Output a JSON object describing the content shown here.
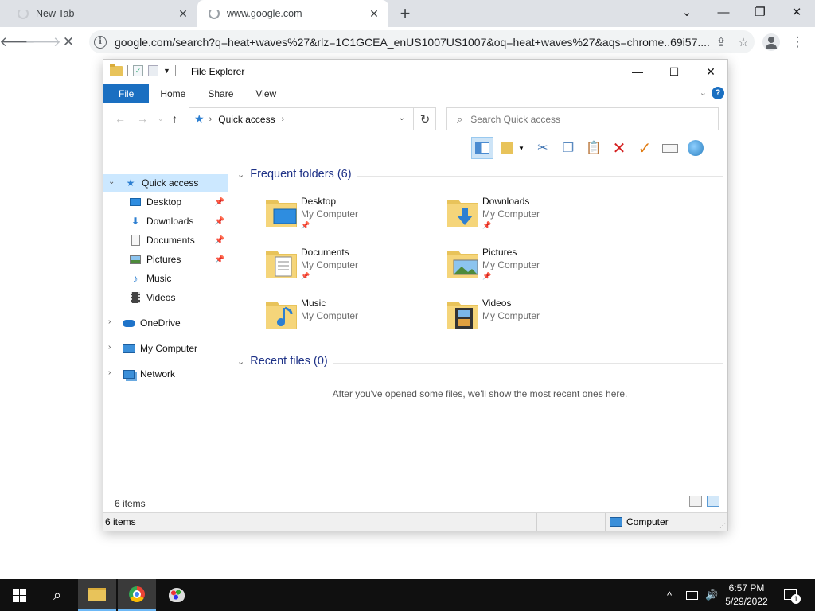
{
  "browser": {
    "tabs": [
      {
        "title": "New Tab",
        "active": false
      },
      {
        "title": "www.google.com",
        "active": true
      }
    ],
    "url": "google.com/search?q=heat+waves%27&rlz=1C1GCEA_enUS1007US1007&oq=heat+waves%27&aqs=chrome..69i57....",
    "icons": {
      "back": "arrow-left-icon",
      "forward": "arrow-right-icon",
      "stop": "close-icon",
      "share": "share-icon",
      "bookmark": "star-icon",
      "profile": "person-icon",
      "menu": "kebab-menu-icon"
    }
  },
  "explorer": {
    "title": "File Explorer",
    "ribbon": {
      "file": "File",
      "home": "Home",
      "share": "Share",
      "view": "View"
    },
    "address": {
      "location": "Quick access"
    },
    "search": {
      "placeholder": "Search Quick access"
    },
    "nav": {
      "quick_access": "Quick access",
      "pinned": [
        "Desktop",
        "Downloads",
        "Documents",
        "Pictures"
      ],
      "unpinned": [
        "Music",
        "Videos"
      ],
      "onedrive": "OneDrive",
      "computer": "My Computer",
      "network": "Network"
    },
    "frequent": {
      "header": "Frequent folders (6)",
      "folders": [
        {
          "name": "Desktop",
          "location": "My Computer",
          "pinned": true
        },
        {
          "name": "Downloads",
          "location": "My Computer",
          "pinned": true
        },
        {
          "name": "Documents",
          "location": "My Computer",
          "pinned": true
        },
        {
          "name": "Pictures",
          "location": "My Computer",
          "pinned": true
        },
        {
          "name": "Music",
          "location": "My Computer",
          "pinned": false
        },
        {
          "name": "Videos",
          "location": "My Computer",
          "pinned": false
        }
      ]
    },
    "recent": {
      "header": "Recent files (0)",
      "empty_message": "After you've opened some files, we'll show the most recent ones here."
    },
    "status": {
      "item_count": "6 items",
      "bar_count": "6 items",
      "location": "Computer"
    },
    "colors": {
      "accent": "#1a6fc1",
      "selection": "#cce8ff",
      "header_text": "#1e3287"
    }
  },
  "taskbar": {
    "time": "6:57 PM",
    "date": "5/29/2022",
    "notification_count": "1"
  }
}
